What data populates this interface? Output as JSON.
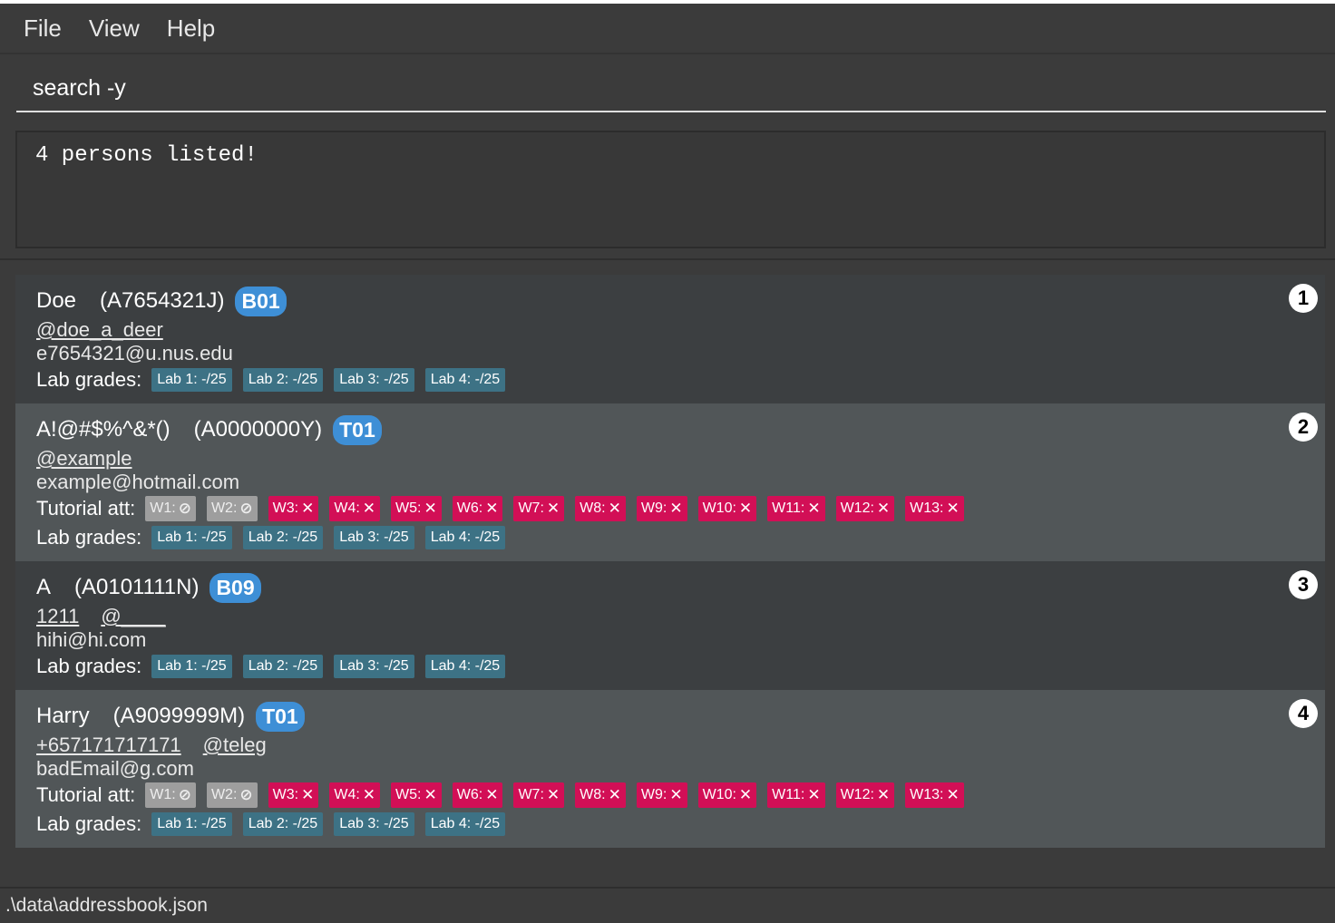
{
  "menu": {
    "file": "File",
    "view": "View",
    "help": "Help"
  },
  "command": {
    "value": "search -y"
  },
  "result": {
    "text": "4 persons listed!"
  },
  "persons": [
    {
      "index": "1",
      "name": "Doe",
      "student_id": "(A7654321J)",
      "group": "B01",
      "phone": "",
      "telegram": "@doe_a_deer",
      "email": "e7654321@u.nus.edu",
      "tutorial_label": "",
      "attendance": [],
      "lab_label": "Lab grades:",
      "labs": [
        "Lab 1: -/25",
        "Lab 2: -/25",
        "Lab 3: -/25",
        "Lab 4: -/25"
      ]
    },
    {
      "index": "2",
      "name": "A!@#$%^&*()",
      "student_id": "(A0000000Y)",
      "group": "T01",
      "phone": "",
      "telegram": "@example",
      "email": "example@hotmail.com",
      "tutorial_label": "Tutorial att:",
      "attendance": [
        {
          "week": "W1:",
          "status": "excused",
          "symbol": "⊘"
        },
        {
          "week": "W2:",
          "status": "excused",
          "symbol": "⊘"
        },
        {
          "week": "W3:",
          "status": "absent",
          "symbol": "✕"
        },
        {
          "week": "W4:",
          "status": "absent",
          "symbol": "✕"
        },
        {
          "week": "W5:",
          "status": "absent",
          "symbol": "✕"
        },
        {
          "week": "W6:",
          "status": "absent",
          "symbol": "✕"
        },
        {
          "week": "W7:",
          "status": "absent",
          "symbol": "✕"
        },
        {
          "week": "W8:",
          "status": "absent",
          "symbol": "✕"
        },
        {
          "week": "W9:",
          "status": "absent",
          "symbol": "✕"
        },
        {
          "week": "W10:",
          "status": "absent",
          "symbol": "✕"
        },
        {
          "week": "W11:",
          "status": "absent",
          "symbol": "✕"
        },
        {
          "week": "W12:",
          "status": "absent",
          "symbol": "✕"
        },
        {
          "week": "W13:",
          "status": "absent",
          "symbol": "✕"
        }
      ],
      "lab_label": "Lab grades:",
      "labs": [
        "Lab 1: -/25",
        "Lab 2: -/25",
        "Lab 3: -/25",
        "Lab 4: -/25"
      ]
    },
    {
      "index": "3",
      "name": "A",
      "student_id": "(A0101111N)",
      "group": "B09",
      "phone": "1211",
      "telegram": "@____",
      "email": "hihi@hi.com",
      "tutorial_label": "",
      "attendance": [],
      "lab_label": "Lab grades:",
      "labs": [
        "Lab 1: -/25",
        "Lab 2: -/25",
        "Lab 3: -/25",
        "Lab 4: -/25"
      ]
    },
    {
      "index": "4",
      "name": "Harry",
      "student_id": "(A9099999M)",
      "group": "T01",
      "phone": "+657171717171",
      "telegram": "@teleg",
      "email": "badEmail@g.com",
      "tutorial_label": "Tutorial att:",
      "attendance": [
        {
          "week": "W1:",
          "status": "excused",
          "symbol": "⊘"
        },
        {
          "week": "W2:",
          "status": "excused",
          "symbol": "⊘"
        },
        {
          "week": "W3:",
          "status": "absent",
          "symbol": "✕"
        },
        {
          "week": "W4:",
          "status": "absent",
          "symbol": "✕"
        },
        {
          "week": "W5:",
          "status": "absent",
          "symbol": "✕"
        },
        {
          "week": "W6:",
          "status": "absent",
          "symbol": "✕"
        },
        {
          "week": "W7:",
          "status": "absent",
          "symbol": "✕"
        },
        {
          "week": "W8:",
          "status": "absent",
          "symbol": "✕"
        },
        {
          "week": "W9:",
          "status": "absent",
          "symbol": "✕"
        },
        {
          "week": "W10:",
          "status": "absent",
          "symbol": "✕"
        },
        {
          "week": "W11:",
          "status": "absent",
          "symbol": "✕"
        },
        {
          "week": "W12:",
          "status": "absent",
          "symbol": "✕"
        },
        {
          "week": "W13:",
          "status": "absent",
          "symbol": "✕"
        }
      ],
      "lab_label": "Lab grades:",
      "labs": [
        "Lab 1: -/25",
        "Lab 2: -/25",
        "Lab 3: -/25",
        "Lab 4: -/25"
      ]
    }
  ],
  "colors": {
    "group_badge": "#3e8fd6",
    "lab_tag": "#3d7285",
    "absent_tag": "#d20f56",
    "excused_tag": "#9e9e9e",
    "card_odd": "#3c3f41",
    "card_even": "#515658"
  },
  "status": {
    "path": ".\\data\\addressbook.json"
  }
}
